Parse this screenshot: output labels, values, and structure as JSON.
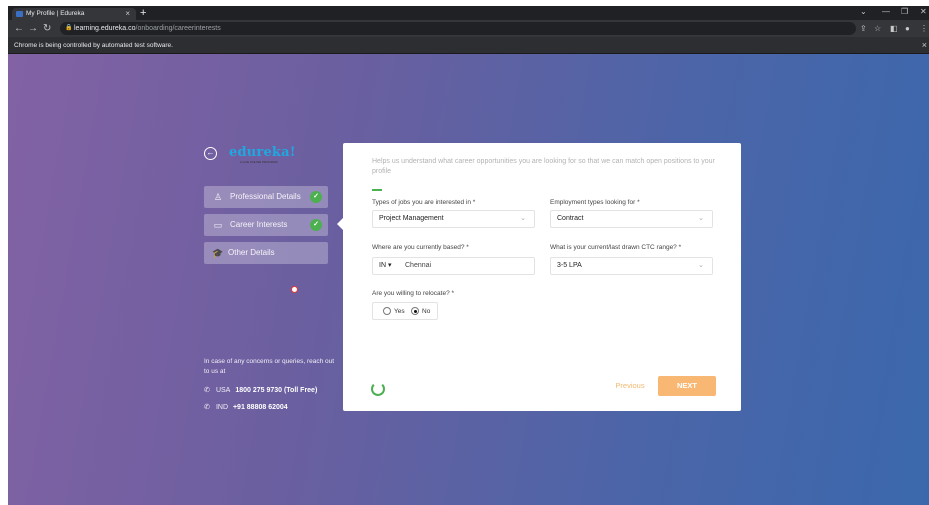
{
  "browser": {
    "tab_title": "My Profile | Edureka",
    "tab_close": "×",
    "new_tab": "+",
    "url_host": "learning.edureka.co",
    "url_path": "/onboarding/careerinterests",
    "infobar_text": "Chrome is being controlled by automated test software.",
    "infobar_close": "×"
  },
  "sidebar": {
    "logo": "edureka!",
    "logo_sub": "A LIVE ONLINE PROGRAM",
    "steps": [
      {
        "label": "Professional Details",
        "icon": "person-icon",
        "completed": true
      },
      {
        "label": "Career Interests",
        "icon": "briefcase-icon",
        "completed": true
      },
      {
        "label": "Other Details",
        "icon": "graduation-cap-icon",
        "completed": false
      }
    ],
    "contact_note": "In case of any concerns or queries, reach out to us at",
    "contacts": [
      {
        "country": "USA",
        "number": "1800 275 9730 (Toll Free)"
      },
      {
        "country": "IND",
        "number": "+91 88808 62004"
      }
    ]
  },
  "form": {
    "help_text": "Helps us understand what career opportunities you are looking for so that we can match open positions to your profile",
    "job_types_label": "Types of jobs you are interested in *",
    "job_types_value": "Project Management",
    "employment_label": "Employment types looking for *",
    "employment_value": "Contract",
    "location_label": "Where are you currently based? *",
    "country_code": "IN ▾",
    "city_value": "Chennai",
    "ctc_label": "What is your current/last drawn CTC range? *",
    "ctc_value": "3-5 LPA",
    "relocate_label": "Are you willing to relocate? *",
    "relocate_yes": "Yes",
    "relocate_no": "No",
    "relocate_selected": "No",
    "previous_label": "Previous",
    "next_label": "NEXT"
  },
  "colors": {
    "accent_green": "#4caf50",
    "next_button": "#f8b873",
    "logo_blue": "#1fa8e0"
  }
}
